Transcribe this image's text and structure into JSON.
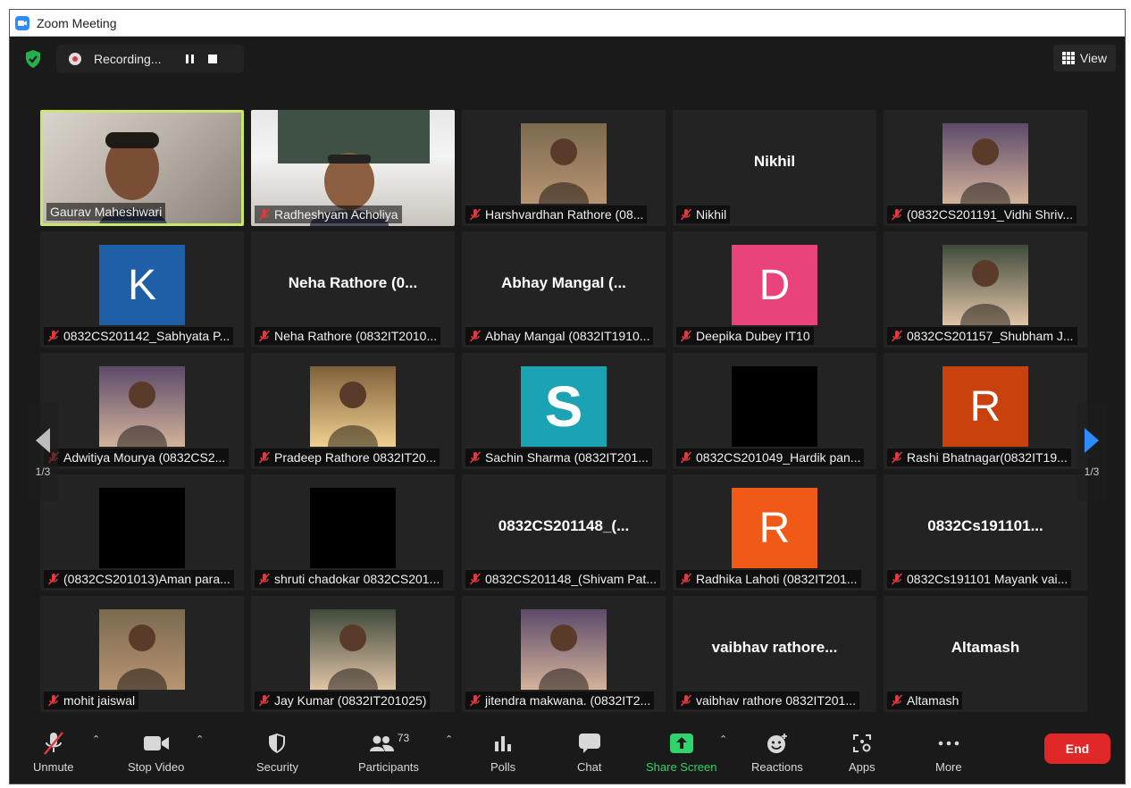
{
  "window": {
    "title": "Zoom Meeting"
  },
  "topbar": {
    "recording_label": "Recording...",
    "view_label": "View"
  },
  "nav": {
    "page_left": "1/3",
    "page_right": "1/3"
  },
  "tiles": [
    {
      "label": "Gaurav Maheshwari",
      "big": "",
      "avatar_letter": "",
      "kind": "video-active"
    },
    {
      "label": "Radheshyam Acholiya",
      "big": "",
      "avatar_letter": "",
      "kind": "video"
    },
    {
      "label": "Harshvardhan Rathore (08...",
      "big": "",
      "avatar_letter": "",
      "kind": "photo"
    },
    {
      "label": "Nikhil",
      "big": "Nikhil",
      "avatar_letter": "",
      "kind": "name"
    },
    {
      "label": "(0832CS201191_Vidhi Shriv...",
      "big": "",
      "avatar_letter": "",
      "kind": "photo"
    },
    {
      "label": "0832CS201142_Sabhyata P...",
      "big": "",
      "avatar_letter": "K",
      "kind": "avatar"
    },
    {
      "label": "Neha Rathore (0832IT2010...",
      "big": "Neha Rathore (0...",
      "avatar_letter": "",
      "kind": "name"
    },
    {
      "label": "Abhay Mangal (0832IT1910...",
      "big": "Abhay Mangal (...",
      "avatar_letter": "",
      "kind": "name"
    },
    {
      "label": "Deepika Dubey IT10",
      "big": "",
      "avatar_letter": "D",
      "kind": "avatar"
    },
    {
      "label": "0832CS201157_Shubham J...",
      "big": "",
      "avatar_letter": "",
      "kind": "photo"
    },
    {
      "label": "Adwitiya Mourya (0832CS2...",
      "big": "",
      "avatar_letter": "",
      "kind": "photo"
    },
    {
      "label": "Pradeep Rathore 0832IT20...",
      "big": "",
      "avatar_letter": "",
      "kind": "photo"
    },
    {
      "label": "Sachin Sharma (0832IT201...",
      "big": "",
      "avatar_letter": "S",
      "kind": "avatar"
    },
    {
      "label": "0832CS201049_Hardik pan...",
      "big": "",
      "avatar_letter": "",
      "kind": "black"
    },
    {
      "label": "Rashi Bhatnagar(0832IT19...",
      "big": "",
      "avatar_letter": "R",
      "kind": "avatar"
    },
    {
      "label": "(0832CS201013)Aman para...",
      "big": "",
      "avatar_letter": "",
      "kind": "black"
    },
    {
      "label": "shruti chadokar 0832CS201...",
      "big": "",
      "avatar_letter": "",
      "kind": "black"
    },
    {
      "label": "0832CS201148_(Shivam Pat...",
      "big": "0832CS201148_(...",
      "avatar_letter": "",
      "kind": "name"
    },
    {
      "label": "Radhika Lahoti (0832IT201...",
      "big": "",
      "avatar_letter": "R",
      "kind": "avatar"
    },
    {
      "label": "0832Cs191101 Mayank vai...",
      "big": "0832Cs191101...",
      "avatar_letter": "",
      "kind": "name"
    },
    {
      "label": "mohit jaiswal",
      "big": "",
      "avatar_letter": "",
      "kind": "photo"
    },
    {
      "label": "Jay Kumar (0832IT201025)",
      "big": "",
      "avatar_letter": "",
      "kind": "photo"
    },
    {
      "label": "jitendra makwana. (0832IT2...",
      "big": "",
      "avatar_letter": "",
      "kind": "photo"
    },
    {
      "label": "vaibhav rathore 0832IT201...",
      "big": "vaibhav  rathore...",
      "avatar_letter": "",
      "kind": "name"
    },
    {
      "label": "Altamash",
      "big": "Altamash",
      "avatar_letter": "",
      "kind": "name"
    }
  ],
  "colors": {
    "avatar_k": "#1f5fa8",
    "avatar_d": "#e8437a",
    "avatar_s": "#1ba3b4",
    "avatar_r1": "#c9410d",
    "avatar_r2": "#f05a16",
    "active_border": "#c8e86c",
    "end": "#e02828",
    "share": "#2fd46a"
  },
  "toolbar": {
    "unmute": "Unmute",
    "stop_video": "Stop Video",
    "security": "Security",
    "participants": "Participants",
    "participants_count": "73",
    "polls": "Polls",
    "chat": "Chat",
    "share_screen": "Share Screen",
    "reactions": "Reactions",
    "apps": "Apps",
    "more": "More",
    "end": "End"
  }
}
